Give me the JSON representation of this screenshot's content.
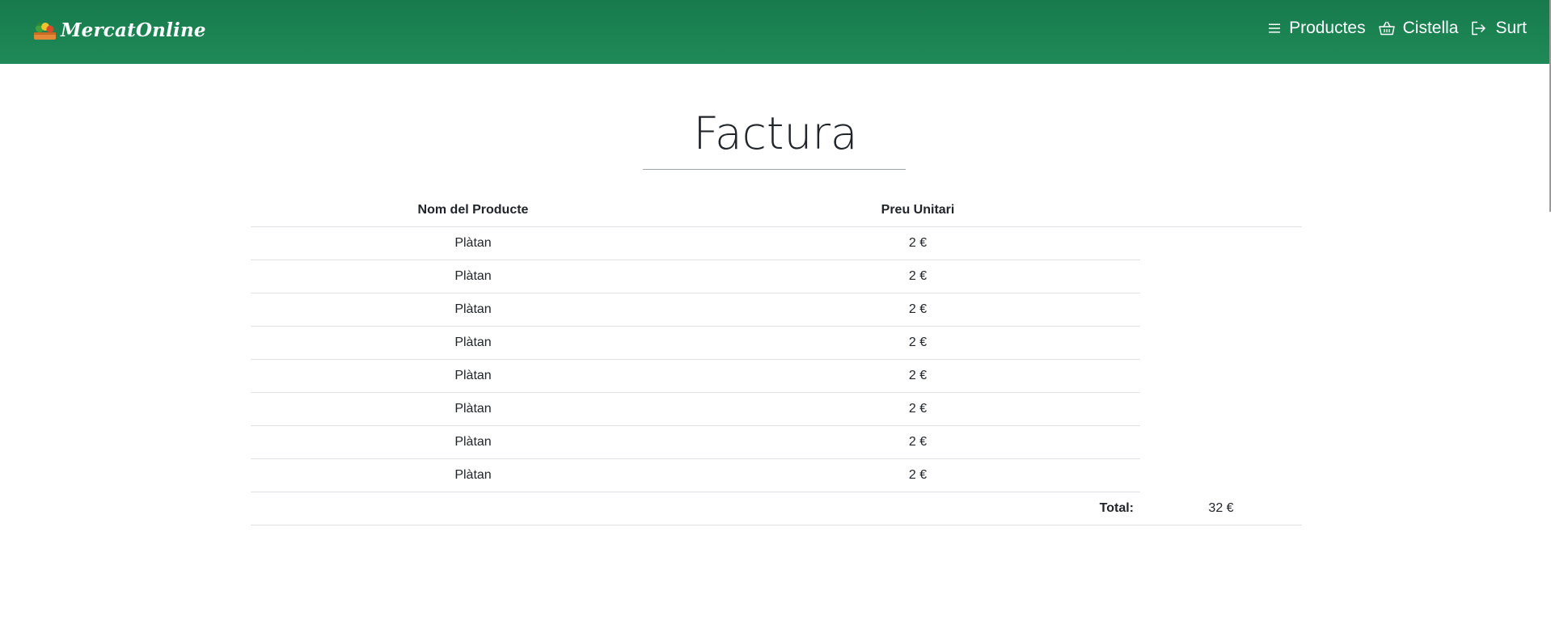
{
  "brand": {
    "name": "MercatOnline"
  },
  "nav": {
    "items": [
      {
        "label": "Productes",
        "icon": "menu-icon"
      },
      {
        "label": "Cistella",
        "icon": "basket-icon"
      },
      {
        "label": "Surt",
        "icon": "logout-icon"
      }
    ]
  },
  "invoice": {
    "title": "Factura",
    "headers": {
      "product": "Nom del Producte",
      "price": "Preu Unitari"
    },
    "rows": [
      {
        "product": "Plàtan",
        "price": "2 €"
      },
      {
        "product": "Plàtan",
        "price": "2 €"
      },
      {
        "product": "Plàtan",
        "price": "2 €"
      },
      {
        "product": "Plàtan",
        "price": "2 €"
      },
      {
        "product": "Plàtan",
        "price": "2 €"
      },
      {
        "product": "Plàtan",
        "price": "2 €"
      },
      {
        "product": "Plàtan",
        "price": "2 €"
      },
      {
        "product": "Plàtan",
        "price": "2 €"
      }
    ],
    "total_label": "Total:",
    "total_value": "32 €"
  },
  "colors": {
    "navbar": "#1b8452",
    "text": "#212529",
    "divider": "#dee2e6"
  }
}
